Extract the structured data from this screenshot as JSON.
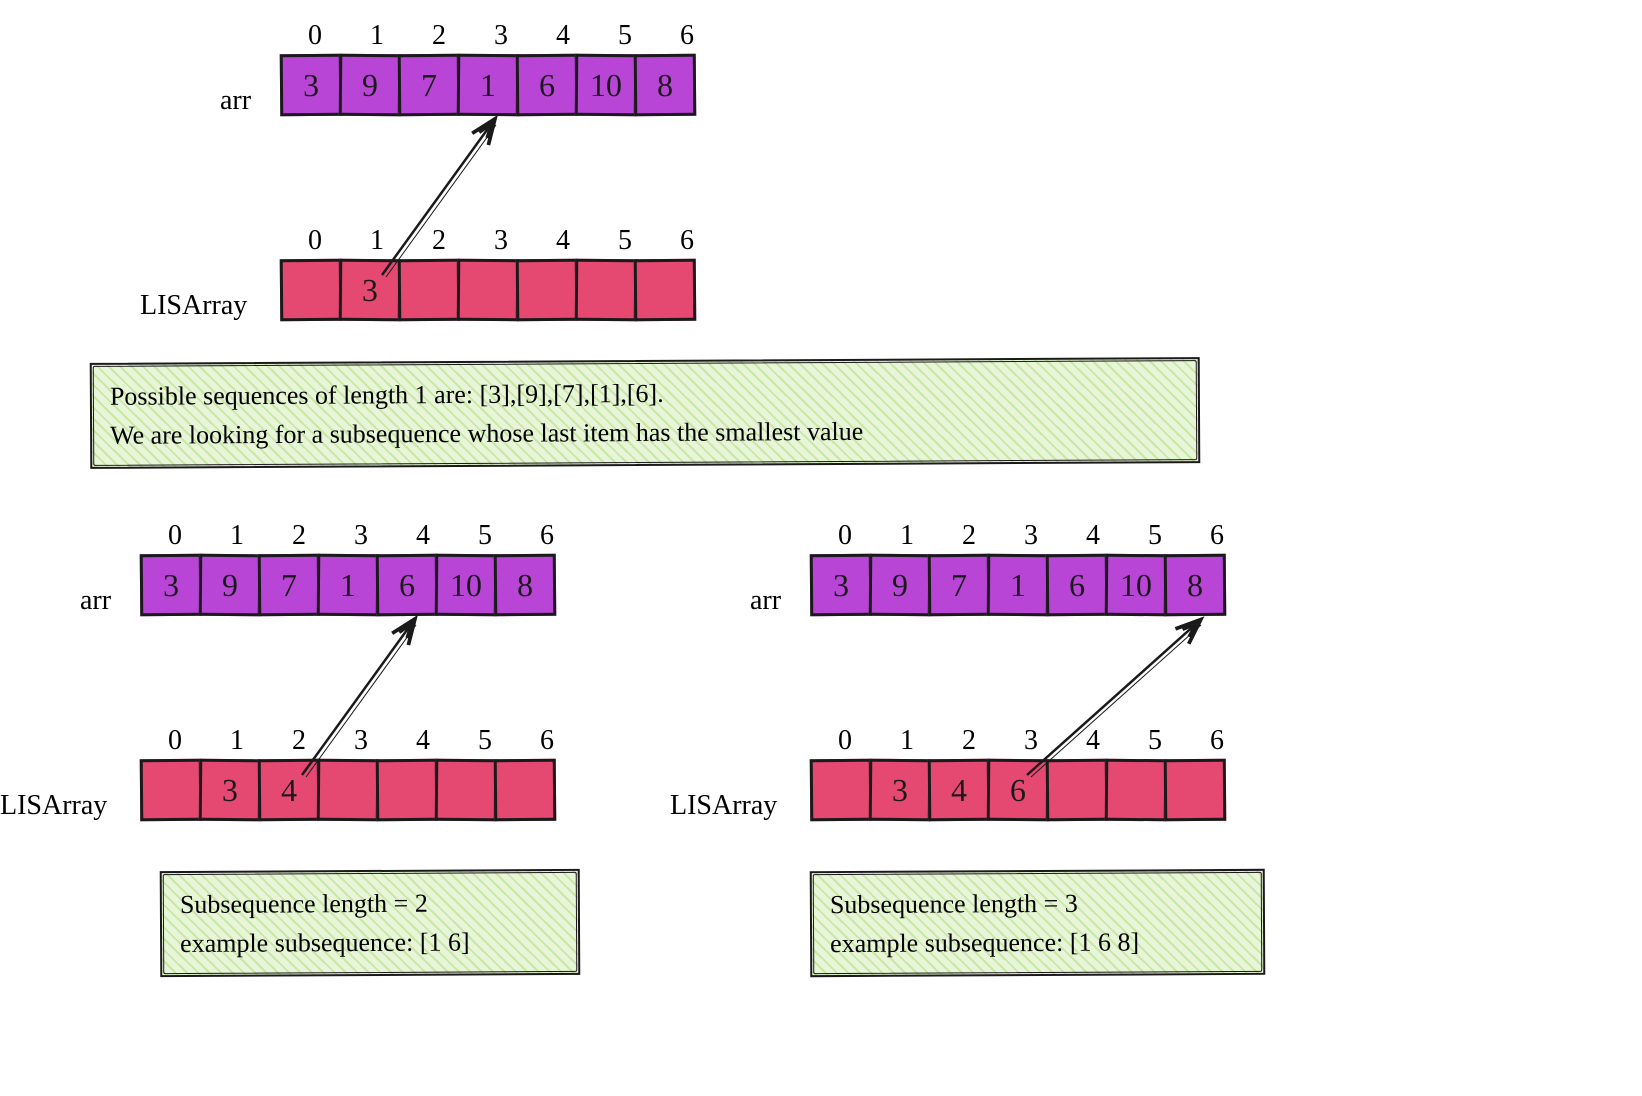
{
  "labels": {
    "arr": "arr",
    "lisarray": "LISArray"
  },
  "top": {
    "indices": [
      "0",
      "1",
      "2",
      "3",
      "4",
      "5",
      "6"
    ],
    "arr": [
      "3",
      "9",
      "7",
      "1",
      "6",
      "10",
      "8"
    ],
    "lis_indices": [
      "0",
      "1",
      "2",
      "3",
      "4",
      "5",
      "6"
    ],
    "lis": [
      "",
      "3",
      "",
      "",
      "",
      "",
      ""
    ]
  },
  "mid_note": {
    "line1": "Possible sequences of length 1 are: [3],[9],[7],[1],[6].",
    "line2": "We are looking for a subsequence whose last item has the smallest value"
  },
  "bottom_left": {
    "indices": [
      "0",
      "1",
      "2",
      "3",
      "4",
      "5",
      "6"
    ],
    "arr": [
      "3",
      "9",
      "7",
      "1",
      "6",
      "10",
      "8"
    ],
    "lis_indices": [
      "0",
      "1",
      "2",
      "3",
      "4",
      "5",
      "6"
    ],
    "lis": [
      "",
      "3",
      "4",
      "",
      "",
      "",
      ""
    ],
    "note_line1": "Subsequence length = 2",
    "note_line2": "example subsequence: [1 6]"
  },
  "bottom_right": {
    "indices": [
      "0",
      "1",
      "2",
      "3",
      "4",
      "5",
      "6"
    ],
    "arr": [
      "3",
      "9",
      "7",
      "1",
      "6",
      "10",
      "8"
    ],
    "lis_indices": [
      "0",
      "1",
      "2",
      "3",
      "4",
      "5",
      "6"
    ],
    "lis": [
      "",
      "3",
      "4",
      "6",
      "",
      "",
      ""
    ],
    "note_line1": "Subsequence length = 3",
    "note_line2": "example subsequence: [1 6 8]"
  }
}
